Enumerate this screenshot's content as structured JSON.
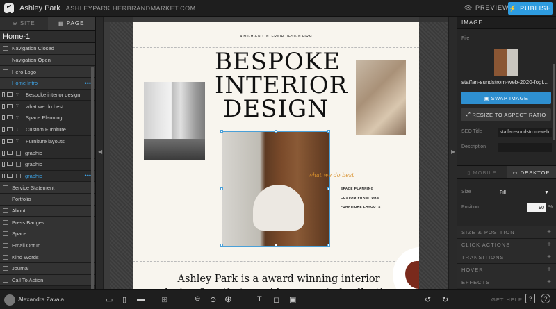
{
  "topbar": {
    "site_name": "Ashley Park",
    "site_url": "ASHLEYPARK.HERBRANDMARKET.COM",
    "preview_label": "PREVIEW",
    "publish_label": "PUBLISH"
  },
  "left": {
    "tabs": [
      {
        "label": "SITE"
      },
      {
        "label": "PAGE"
      }
    ],
    "page_title": "Home-1",
    "layers": [
      {
        "label": "Navigation Closed"
      },
      {
        "label": "Navigation Open"
      },
      {
        "label": "Hero Logo"
      },
      {
        "label": "Home Intro",
        "selected": true
      },
      {
        "label": "Bespoke interior design",
        "sub": true,
        "type": "T"
      },
      {
        "label": "what we do best",
        "sub": true,
        "type": "T"
      },
      {
        "label": "Space Planning",
        "sub": true,
        "type": "T"
      },
      {
        "label": "Custom Furniture",
        "sub": true,
        "type": "T"
      },
      {
        "label": "Furniture layouts",
        "sub": true,
        "type": "T"
      },
      {
        "label": "graphic",
        "sub": true,
        "type": "box"
      },
      {
        "label": "graphic",
        "sub": true,
        "type": "box"
      },
      {
        "label": "graphic",
        "sub": true,
        "type": "box",
        "selected": true
      },
      {
        "label": "Service Statement"
      },
      {
        "label": "Portfolio"
      },
      {
        "label": "About"
      },
      {
        "label": "Press Badges"
      },
      {
        "label": "Space"
      },
      {
        "label": "Email Opt In"
      },
      {
        "label": "Kind Words"
      },
      {
        "label": "Journal"
      },
      {
        "label": "Call To Action"
      }
    ]
  },
  "canvas": {
    "tagline": "A HIGH-END INTERIOR DESIGN FIRM",
    "headline": [
      "BESPOKE",
      "INTERIOR",
      "DESIGN"
    ],
    "script_text": "what we do best",
    "services": [
      "SPACE PLANNING",
      "CUSTOM FURNITURE",
      "FURNITURE LAYOUTS"
    ],
    "body": "Ashley Park is a award winning interior design firm that provides a curated collection of bespoke furniture and"
  },
  "right": {
    "header": "IMAGE",
    "file_label": "File",
    "file_name": "staffan-sundstrom-web-2020-fogi...",
    "swap_label": "SWAP IMAGE",
    "resize_label": "RESIZE TO ASPECT RATIO",
    "seo_label": "SEO Title",
    "seo_value": "staffan-sundstrom-web",
    "desc_label": "Description",
    "desc_value": "",
    "device_tabs": [
      {
        "label": "MOBILE"
      },
      {
        "label": "DESKTOP"
      }
    ],
    "size_label": "Size",
    "size_value": "Fill",
    "position_label": "Position",
    "position_value": "90",
    "position_unit": "%",
    "sections": [
      "SIZE & POSITION",
      "CLICK ACTIONS",
      "TRANSITIONS",
      "HOVER",
      "EFFECTS"
    ]
  },
  "bottom": {
    "user_name": "Alexandra Zavala",
    "get_help": "GET HELP",
    "help_key": "?"
  }
}
